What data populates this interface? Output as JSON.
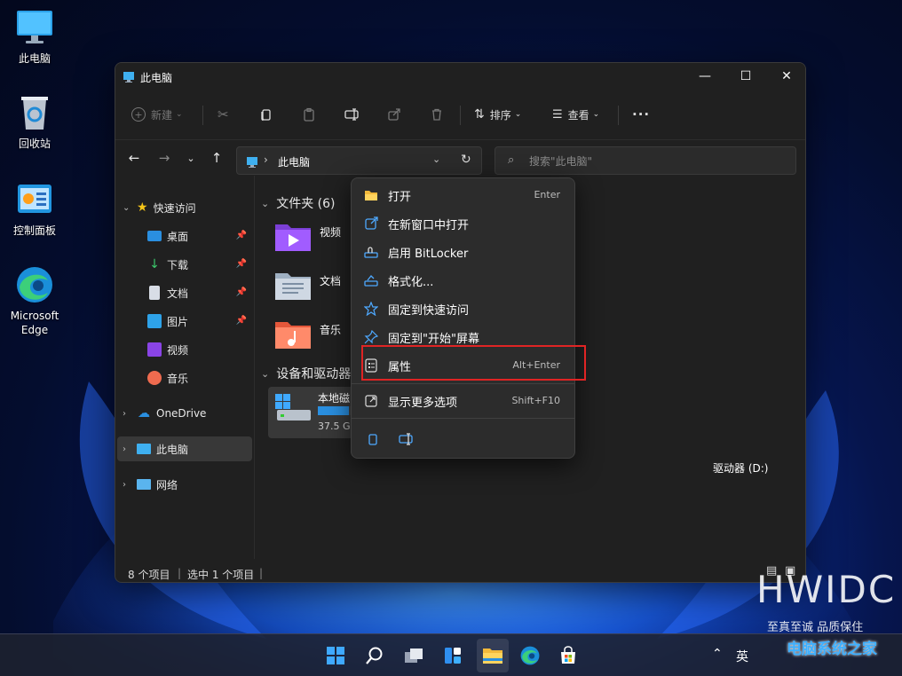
{
  "desktop": {
    "icons": [
      {
        "label": "此电脑"
      },
      {
        "label": "回收站"
      },
      {
        "label": "控制面板"
      },
      {
        "label": "Microsoft\nEdge"
      }
    ]
  },
  "window": {
    "title": "此电脑",
    "controls": {
      "minimize": "—",
      "maximize": "☐",
      "close": "✕"
    }
  },
  "toolbar": {
    "new_label": "新建",
    "sort_label": "排序",
    "view_label": "查看",
    "more_label": "···"
  },
  "nav": {
    "address": "此电脑",
    "search_placeholder": "搜索\"此电脑\""
  },
  "sidebar": {
    "quick_access": "快速访问",
    "items": [
      {
        "label": "桌面"
      },
      {
        "label": "下载"
      },
      {
        "label": "文档"
      },
      {
        "label": "图片"
      },
      {
        "label": "视频"
      },
      {
        "label": "音乐"
      }
    ],
    "onedrive": "OneDrive",
    "this_pc": "此电脑",
    "network": "网络"
  },
  "content": {
    "folders_header": "文件夹 (6)",
    "folders": [
      {
        "label": "视频"
      },
      {
        "label": "文档"
      },
      {
        "label": "音乐"
      }
    ],
    "devices_header": "设备和驱动器",
    "drive_label": "本地磁",
    "drive_size": "37.5 G",
    "dvd_label": "驱动器 (D:)"
  },
  "status": {
    "count": "8 个项目",
    "selected": "选中 1 个项目"
  },
  "context_menu": {
    "items": [
      {
        "label": "打开",
        "shortcut": "Enter"
      },
      {
        "label": "在新窗口中打开",
        "shortcut": ""
      },
      {
        "label": "启用 BitLocker",
        "shortcut": ""
      },
      {
        "label": "格式化...",
        "shortcut": ""
      },
      {
        "label": "固定到快速访问",
        "shortcut": ""
      },
      {
        "label": "固定到\"开始\"屏幕",
        "shortcut": ""
      },
      {
        "label": "属性",
        "shortcut": "Alt+Enter"
      },
      {
        "label": "显示更多选项",
        "shortcut": "Shift+F10"
      }
    ]
  },
  "taskbar": {
    "ime": "英"
  },
  "watermark": {
    "brand": "HWIDC",
    "slogan": "至真至诚 品质保住",
    "site": "电脑系统之家"
  },
  "colors": {
    "accent": "#0078d4",
    "highlight_red": "#e02424",
    "window_bg": "#202020",
    "menu_bg": "#2c2c2c"
  }
}
